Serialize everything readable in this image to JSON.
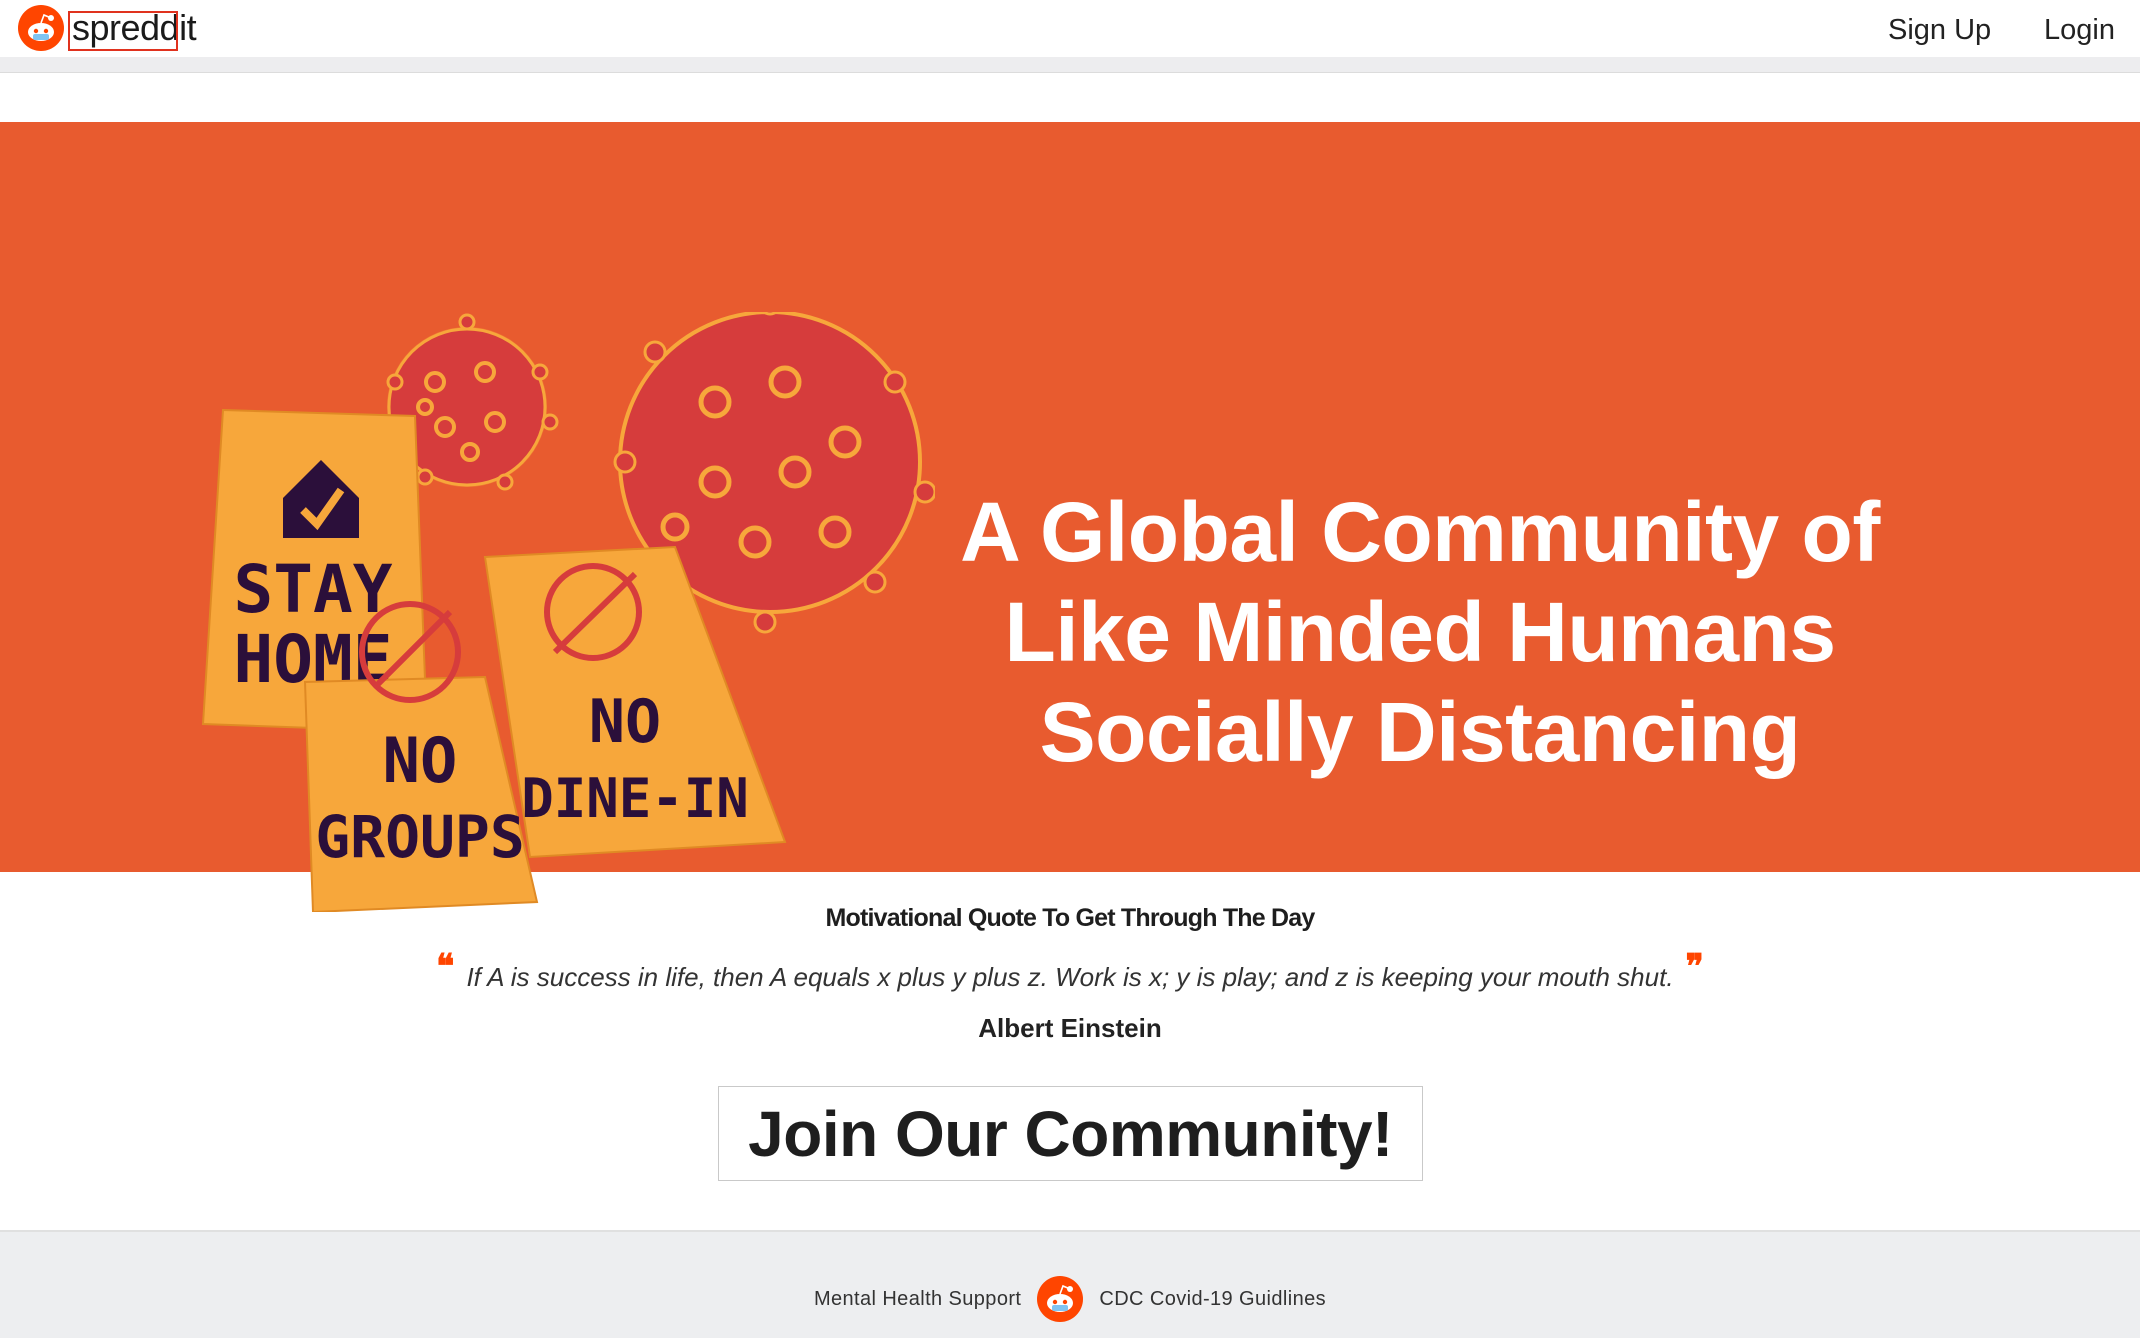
{
  "brand": {
    "name": "spreddit",
    "logo_icon": "spreddit-alien-icon"
  },
  "nav": {
    "signup_label": "Sign Up",
    "login_label": "Login"
  },
  "hero": {
    "title_lines": [
      "A Global Community of",
      "Like Minded Humans",
      "Socially Distancing"
    ],
    "illustration": {
      "notes": [
        "STAY HOME",
        "NO GROUPS",
        "NO DINE-IN"
      ]
    }
  },
  "quote": {
    "heading": "Motivational Quote To Get Through The Day",
    "text": "If A is success in life, then A equals x plus y plus z. Work is x; y is play; and z is keeping your mouth shut.",
    "author": "Albert Einstein",
    "open_mark": "❝",
    "close_mark": "❞"
  },
  "cta": {
    "label": "Join Our Community!"
  },
  "footer": {
    "left_link": "Mental Health Support",
    "right_link": "CDC Covid-19 Guidlines"
  },
  "colors": {
    "hero_bg": "#e85b2f",
    "brand_orange": "#ff4500",
    "sticky_note": "#f7a73b",
    "virus": "#d63c3c"
  }
}
